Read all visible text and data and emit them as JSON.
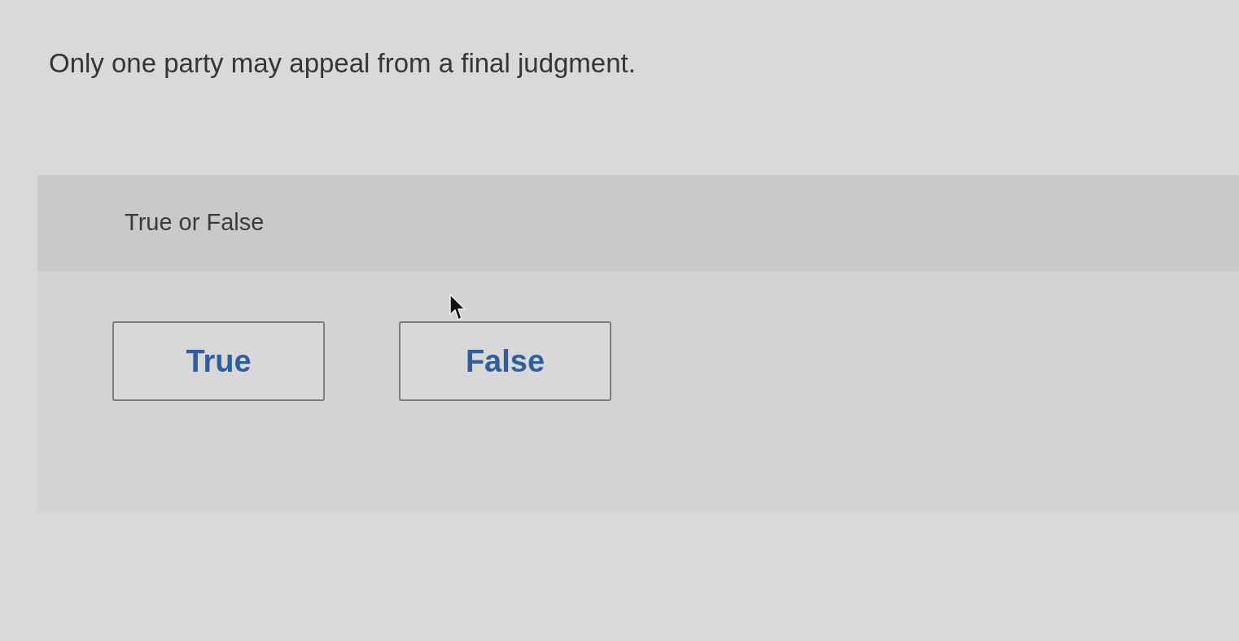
{
  "question": {
    "text": "Only one party may appeal from a final judgment."
  },
  "answer_panel": {
    "prompt": "True or False",
    "options": [
      {
        "label": "True",
        "selected": false
      },
      {
        "label": "False",
        "selected": false
      }
    ]
  }
}
